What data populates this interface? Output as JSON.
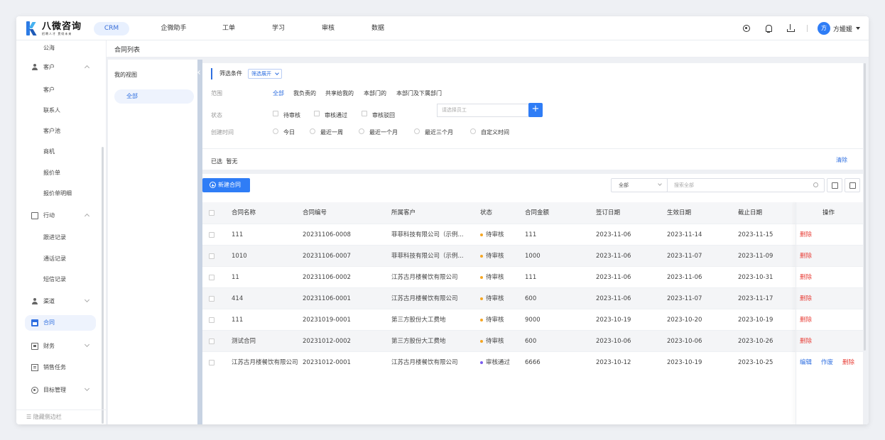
{
  "brand": {
    "name": "八微咨询",
    "tagline": "招聘人才 贯彻未来"
  },
  "nav": {
    "tabs": [
      {
        "label": "CRM",
        "active": true
      },
      {
        "label": "企微助手"
      },
      {
        "label": "工单"
      },
      {
        "label": "学习"
      },
      {
        "label": "审核"
      },
      {
        "label": "数据"
      }
    ],
    "user": {
      "avatar_text": "方",
      "name": "方媛媛"
    },
    "icons": [
      "target-icon",
      "bell-icon",
      "download-icon"
    ]
  },
  "sidebar": {
    "items": [
      {
        "label": "公海",
        "type": "sub"
      },
      {
        "label": "客户",
        "type": "group",
        "icon": "person-icon",
        "expanded": true
      },
      {
        "label": "客户",
        "type": "sub"
      },
      {
        "label": "联系人",
        "type": "sub"
      },
      {
        "label": "客户池",
        "type": "sub"
      },
      {
        "label": "商机",
        "type": "sub"
      },
      {
        "label": "报价单",
        "type": "sub"
      },
      {
        "label": "报价单明细",
        "type": "sub"
      },
      {
        "label": "行动",
        "type": "group",
        "icon": "pen-icon",
        "expanded": true
      },
      {
        "label": "跟进记录",
        "type": "sub"
      },
      {
        "label": "通话记录",
        "type": "sub"
      },
      {
        "label": "短信记录",
        "type": "sub"
      },
      {
        "label": "渠道",
        "type": "group",
        "icon": "person-icon",
        "expanded": false
      },
      {
        "label": "合同",
        "type": "group",
        "icon": "contract-icon",
        "active": true
      },
      {
        "label": "财务",
        "type": "group",
        "icon": "wallet-icon",
        "expanded": false
      },
      {
        "label": "销售任务",
        "type": "group",
        "icon": "list-icon"
      },
      {
        "label": "目标管理",
        "type": "group",
        "icon": "goal-icon",
        "expanded": false
      }
    ],
    "footer": "☰ 隐藏侧边栏"
  },
  "page": {
    "title": "合同列表"
  },
  "views": {
    "title": "我的视图",
    "all": "全部"
  },
  "filter": {
    "title": "筛选条件",
    "expand": "筛选展开",
    "scope_label": "范围",
    "scope_options": [
      "全部",
      "我负责的",
      "共享给我的",
      "本部门的",
      "本部门及下属部门"
    ],
    "scope_active": "全部",
    "employee_placeholder": "请选择员工",
    "add": "+",
    "status_label": "状态",
    "status_options": [
      "待审核",
      "审核通过",
      "审核驳回"
    ],
    "time_label": "创建时间",
    "time_options": [
      "今日",
      "最近一周",
      "最近一个月",
      "最近三个月",
      "自定义时间"
    ],
    "selected_label": "已选",
    "selected_value": "暂无",
    "clear": "清除"
  },
  "toolbar": {
    "new_contract": "新建合同",
    "scope_select": "全部",
    "search_placeholder": "搜索全部"
  },
  "table": {
    "columns": [
      "合同名称",
      "合同编号",
      "所属客户",
      "状态",
      "合同金额",
      "签订日期",
      "生效日期",
      "截止日期",
      "操作"
    ],
    "rows": [
      {
        "name": "111",
        "code": "20231106-0008",
        "customer": "菲菲科技有限公司（示例...",
        "status": "待审核",
        "amount": "111",
        "signed": "2023-11-06",
        "effective": "2023-11-14",
        "deadline": "2023-11-15",
        "actions": [
          "删除"
        ]
      },
      {
        "name": "1010",
        "code": "20231106-0007",
        "customer": "菲菲科技有限公司（示例...",
        "status": "待审核",
        "amount": "1000",
        "signed": "2023-11-06",
        "effective": "2023-11-07",
        "deadline": "2023-11-09",
        "actions": [
          "删除"
        ]
      },
      {
        "name": "11",
        "code": "20231106-0002",
        "customer": "江苏古月楼餐饮有限公司",
        "status": "待审核",
        "amount": "111",
        "signed": "2023-11-06",
        "effective": "2023-11-06",
        "deadline": "2023-10-31",
        "actions": [
          "删除"
        ]
      },
      {
        "name": "414",
        "code": "20231106-0001",
        "customer": "江苏古月楼餐饮有限公司",
        "status": "待审核",
        "amount": "600",
        "signed": "2023-11-06",
        "effective": "2023-11-07",
        "deadline": "2023-11-17",
        "actions": [
          "删除"
        ]
      },
      {
        "name": "111",
        "code": "20231019-0001",
        "customer": "第三方股份大工费地",
        "status": "待审核",
        "amount": "9000",
        "signed": "2023-10-19",
        "effective": "2023-10-20",
        "deadline": "2023-10-19",
        "actions": [
          "删除"
        ]
      },
      {
        "name": "测试合同",
        "code": "20231012-0002",
        "customer": "第三方股份大工费地",
        "status": "待审核",
        "amount": "600",
        "signed": "2023-10-06",
        "effective": "2023-10-06",
        "deadline": "2023-10-26",
        "actions": [
          "删除"
        ]
      },
      {
        "name": "江苏古月楼餐饮有限公司",
        "code": "20231012-0001",
        "customer": "江苏古月楼餐饮有限公司",
        "status": "审核通过",
        "amount": "6666",
        "signed": "2023-10-12",
        "effective": "2023-10-19",
        "deadline": "2023-10-25",
        "actions": [
          "编辑",
          "作废",
          "删除"
        ]
      }
    ]
  },
  "colors": {
    "primary": "#2f7df6",
    "pending": "#f5a623",
    "approved": "#7b5cf0",
    "danger": "#e8413a"
  }
}
